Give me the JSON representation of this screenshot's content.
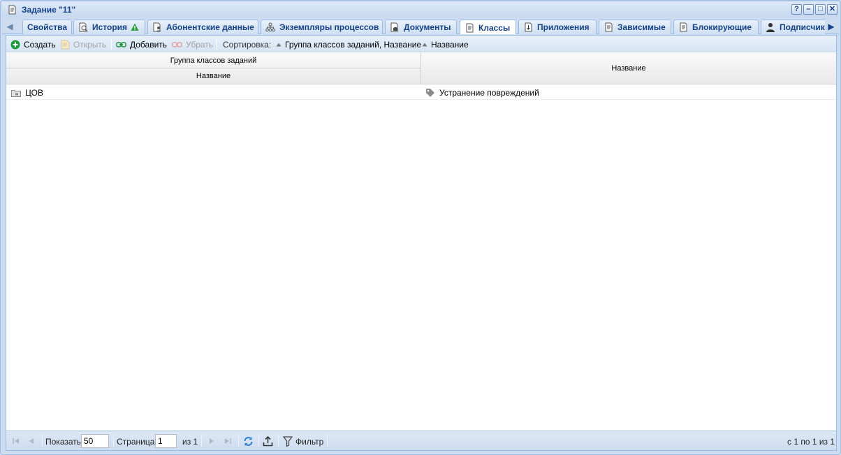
{
  "window": {
    "title": "Задание \"11\"",
    "title_icon": "document-icon"
  },
  "title_buttons": [
    {
      "name": "help-button",
      "glyph": "?"
    },
    {
      "name": "minimize-button",
      "glyph": "–"
    },
    {
      "name": "maximize-button",
      "glyph": "□"
    },
    {
      "name": "close-button",
      "glyph": "✕"
    }
  ],
  "tabs": [
    {
      "label": "Свойства",
      "icon": ""
    },
    {
      "label": "История",
      "icon": "history-icon",
      "warning": true
    },
    {
      "label": "Абонентские данные",
      "icon": "subscriber-icon"
    },
    {
      "label": "Экземпляры процессов",
      "icon": "process-icon"
    },
    {
      "label": "Документы",
      "icon": "documents-icon"
    },
    {
      "label": "Классы",
      "icon": "document-icon",
      "active": true
    },
    {
      "label": "Приложения",
      "icon": "attachment-icon"
    },
    {
      "label": "Зависимые",
      "icon": "document-icon"
    },
    {
      "label": "Блокирующие",
      "icon": "document-icon"
    },
    {
      "label": "Подписчики",
      "icon": "user-icon"
    }
  ],
  "toolbar": {
    "create": "Создать",
    "open": "Открыть",
    "add": "Добавить",
    "remove": "Убрать",
    "sort_label": "Сортировка:",
    "sort_1": "Группа классов заданий, Название",
    "sort_2": "Название"
  },
  "grid": {
    "group_header": "Группа классов заданий",
    "col1_header": "Название",
    "col2_header": "Название",
    "rows": [
      {
        "group_name": "ЦОВ",
        "name": "Устранение повреждений"
      }
    ]
  },
  "pager": {
    "show_label": "Показать",
    "page_size": "50",
    "page_label": "Страница",
    "page": "1",
    "of_label": "из 1",
    "filter_label": "Фильтр",
    "summary": "с 1 по 1 из 1"
  },
  "colors": {
    "accent": "#15428b",
    "border": "#99bbe8",
    "add_green": "#1a9b3c"
  }
}
